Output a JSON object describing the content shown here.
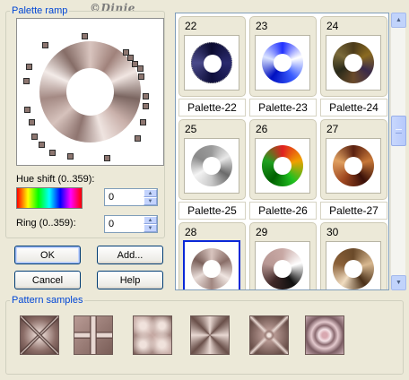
{
  "watermark": "©Dinie",
  "palette_ramp": {
    "title": "Palette ramp",
    "hue_label": "Hue shift (0..359):",
    "hue_value": "0",
    "ring_label": "Ring (0..359):",
    "ring_value": "0"
  },
  "buttons": {
    "ok": "OK",
    "add": "Add...",
    "cancel": "Cancel",
    "help": "Help"
  },
  "palettes": [
    {
      "num": "22",
      "label": "Palette-22"
    },
    {
      "num": "23",
      "label": "Palette-23"
    },
    {
      "num": "24",
      "label": "Palette-24"
    },
    {
      "num": "25",
      "label": "Palette-25"
    },
    {
      "num": "26",
      "label": "Palette-26"
    },
    {
      "num": "27",
      "label": "Palette-27"
    },
    {
      "num": "28",
      "label": ""
    },
    {
      "num": "29",
      "label": ""
    },
    {
      "num": "30",
      "label": ""
    }
  ],
  "selected_palette": "28",
  "pattern_samples": {
    "title": "Pattern samples",
    "count": 6
  },
  "icons": {
    "scroll_up": "arrow-up-icon",
    "scroll_down": "arrow-down-icon",
    "spin_up": "arrow-up-icon",
    "spin_down": "arrow-down-icon"
  },
  "colors": {
    "accent_blue": "#0046d5",
    "selection": "#0a28d8",
    "dialog_bg": "#ece9d8"
  }
}
